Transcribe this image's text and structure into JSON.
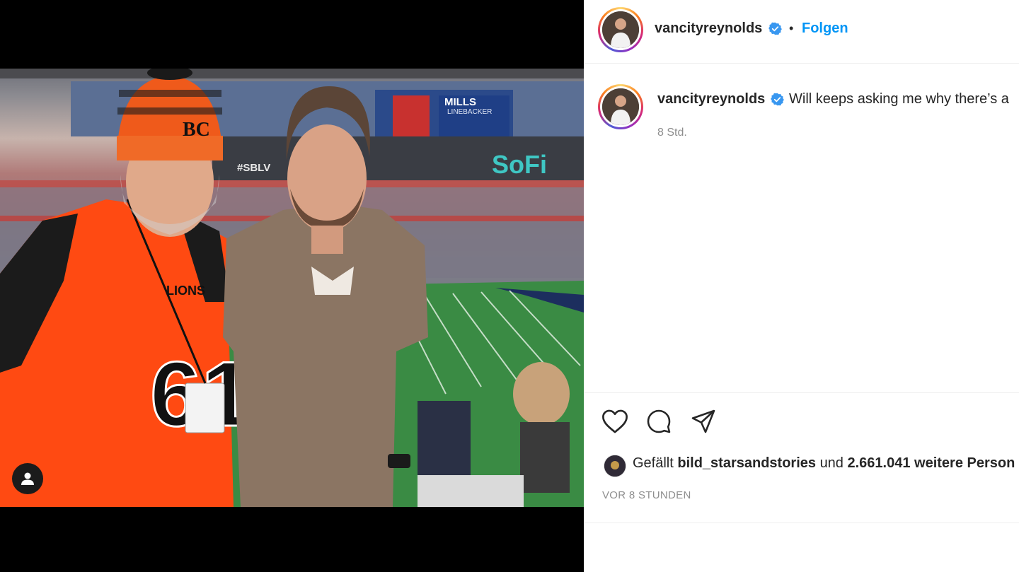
{
  "post": {
    "author": "vancityreynolds",
    "follow_label": "Folgen",
    "separator": "•",
    "caption_user": "vancityreynolds",
    "caption_text": "Will keeps asking me why there’s a",
    "relative_time": "8 Std.",
    "likes_prefix": "Gefällt",
    "likes_user": "bild_starsandstories",
    "likes_connector": "und",
    "likes_rest": "2.661.041 weitere Person",
    "posted_ago": "VOR 8 STUNDEN"
  },
  "photo": {
    "scoreboard_text": "#SBLV",
    "venue_text": "SoFi",
    "jumbotron_caption": "MILLS",
    "jumbotron_sub": "LINEBACKER",
    "jersey_number": "61",
    "jersey_text": "LIONS",
    "hat_logo": "BC",
    "alt": ""
  },
  "icons": {
    "like": "heart-icon",
    "comment": "comment-icon",
    "share": "send-icon",
    "verified": "verified-badge-icon",
    "user_tag": "user-tag-icon"
  },
  "colors": {
    "follow": "#0095f6",
    "verified": "#3897f0",
    "text": "#262626",
    "muted": "#8e8e8e",
    "jersey": "#ff4a12"
  }
}
